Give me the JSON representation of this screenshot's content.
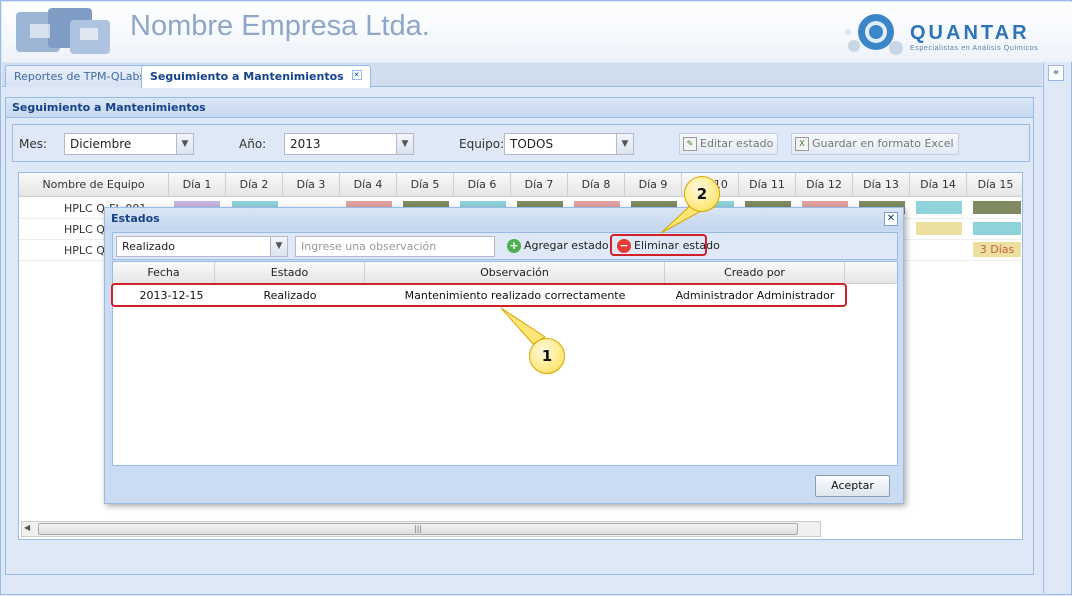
{
  "header": {
    "company_name": "Nombre Empresa Ltda.",
    "brand_name": "QUANTAR",
    "brand_tagline": "Especialistas en Análisis Químicos"
  },
  "tabs": [
    {
      "label": "Reportes de TPM-QLabs",
      "active": false
    },
    {
      "label": "Seguimiento a Mantenimientos",
      "active": true
    }
  ],
  "panel": {
    "title": "Seguimiento a Mantenimientos"
  },
  "filters": {
    "mes_label": "Mes:",
    "mes_value": "Diciembre",
    "anio_label": "Año:",
    "anio_value": "2013",
    "equipo_label": "Equipo:",
    "equipo_value": "TODOS",
    "edit_button": "Editar estado",
    "excel_button": "Guardar en formato Excel"
  },
  "grid": {
    "columns": [
      "Nombre de Equipo",
      "Día 1",
      "Día 2",
      "Día 3",
      "Día 4",
      "Día 5",
      "Día 6",
      "Día 7",
      "Día 8",
      "Día 9",
      "Día 10",
      "Día 11",
      "Día 12",
      "Día 13",
      "Día 14",
      "Día 15"
    ],
    "rows": [
      {
        "name": "HPLC Q-FL-001"
      },
      {
        "name": "HPLC Q-"
      },
      {
        "name": "HPLC Q-"
      }
    ],
    "row3_day15_text": "3 Días",
    "colors": {
      "purple": "#c8b4e0",
      "cyan": "#8fd2da",
      "red": "#e2a3a0",
      "olive": "#808a60",
      "yellow": "#ece0a0"
    }
  },
  "modal": {
    "title": "Estados",
    "estado_select": "Realizado",
    "observacion_placeholder": "Ingrese una observación",
    "add_button": "Agregar estado",
    "delete_button": "Eliminar estado",
    "columns": [
      "Fecha",
      "Estado",
      "Observación",
      "Creado por"
    ],
    "rows": [
      {
        "fecha": "2013-12-15",
        "estado": "Realizado",
        "observacion": "Mantenimiento realizado correctamente",
        "creado_por": "Administrador Administrador"
      }
    ],
    "ok_button": "Aceptar"
  },
  "annotations": {
    "callout_1": "1",
    "callout_2": "2",
    "highlight_color": "#d0202a"
  }
}
